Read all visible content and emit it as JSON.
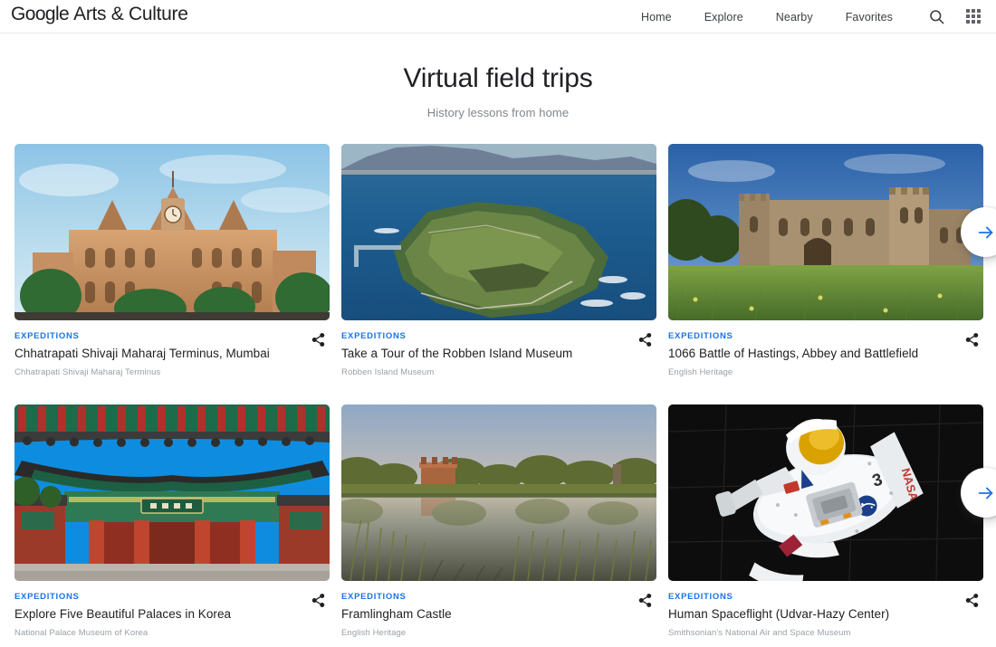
{
  "header": {
    "brand_google": "Google",
    "brand_product": "Arts & Culture",
    "nav": [
      {
        "label": "Home"
      },
      {
        "label": "Explore"
      },
      {
        "label": "Nearby"
      },
      {
        "label": "Favorites"
      }
    ],
    "search_icon": "search-icon",
    "apps_icon": "apps-grid-icon"
  },
  "page": {
    "title": "Virtual field trips",
    "subtitle": "History lessons from home"
  },
  "colors": {
    "accent_blue": "#1a73e8",
    "text_primary": "#202124",
    "text_muted": "#9aa0a6"
  },
  "carousel": {
    "next_label": "Next",
    "next_icon": "arrow-right-icon"
  },
  "share_icon": "share-icon",
  "rows": [
    {
      "cards": [
        {
          "kicker": "EXPEDITIONS",
          "title": "Chhatrapati Shivaji Maharaj Terminus, Mumbai",
          "owner": "Chhatrapati Shivaji Maharaj Terminus",
          "image_alt": "victoria-terminus-station"
        },
        {
          "kicker": "EXPEDITIONS",
          "title": "Take a Tour of the Robben Island Museum",
          "owner": "Robben Island Museum",
          "image_alt": "robben-island-aerial"
        },
        {
          "kicker": "EXPEDITIONS",
          "title": "1066 Battle of Hastings, Abbey and Battlefield",
          "owner": "English Heritage",
          "image_alt": "battle-abbey-castle"
        }
      ]
    },
    {
      "cards": [
        {
          "kicker": "EXPEDITIONS",
          "title": "Explore Five Beautiful Palaces in Korea",
          "owner": "National Palace Museum of Korea",
          "image_alt": "korean-palace-gate"
        },
        {
          "kicker": "EXPEDITIONS",
          "title": "Framlingham Castle",
          "owner": "English Heritage",
          "image_alt": "framlingham-castle-lake"
        },
        {
          "kicker": "EXPEDITIONS",
          "title": "Human Spaceflight (Udvar-Hazy Center)",
          "owner": "Smithsonian's National Air and Space Museum",
          "image_alt": "astronaut-spacesuit"
        }
      ]
    }
  ]
}
